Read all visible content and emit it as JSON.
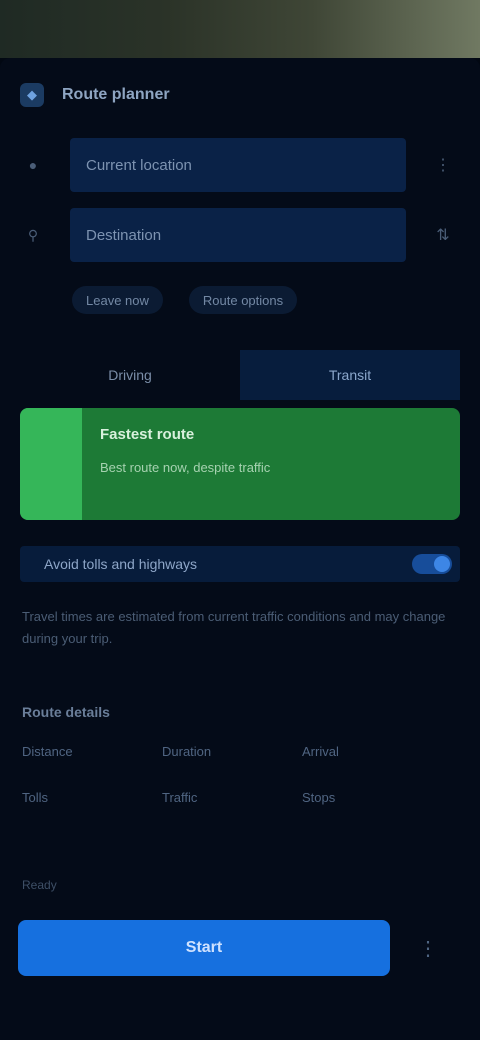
{
  "header": {
    "title": "Route planner",
    "app_icon": "map-icon"
  },
  "route": {
    "from": {
      "value": "Current location",
      "icon": "origin-dot-icon",
      "action_icon": "more-vertical-icon"
    },
    "to": {
      "value": "Destination",
      "icon": "pin-icon",
      "action_icon": "swap-icon"
    }
  },
  "chips": [
    "Leave now",
    "Route options"
  ],
  "modes": [
    {
      "label": "Driving",
      "active": false
    },
    {
      "label": "Transit",
      "active": true
    }
  ],
  "card": {
    "title": "Fastest route",
    "subtitle": "Best route now, despite traffic"
  },
  "info": {
    "text": "Avoid tolls and highways",
    "toggle_on": true
  },
  "description": "Travel times are estimated from current traffic conditions and may change during your trip.",
  "details": {
    "title": "Route details",
    "rows": [
      [
        "Distance",
        "Duration",
        "Arrival"
      ],
      [
        "Tolls",
        "Traffic",
        "Stops"
      ]
    ]
  },
  "footer": {
    "label": "Ready",
    "start_label": "Start",
    "more_icon": "more-icon"
  },
  "colors": {
    "accent": "#1670df",
    "card": "#1d7a36",
    "card_stripe": "#35b659",
    "field": "#0a2247",
    "background": "#040b18"
  }
}
